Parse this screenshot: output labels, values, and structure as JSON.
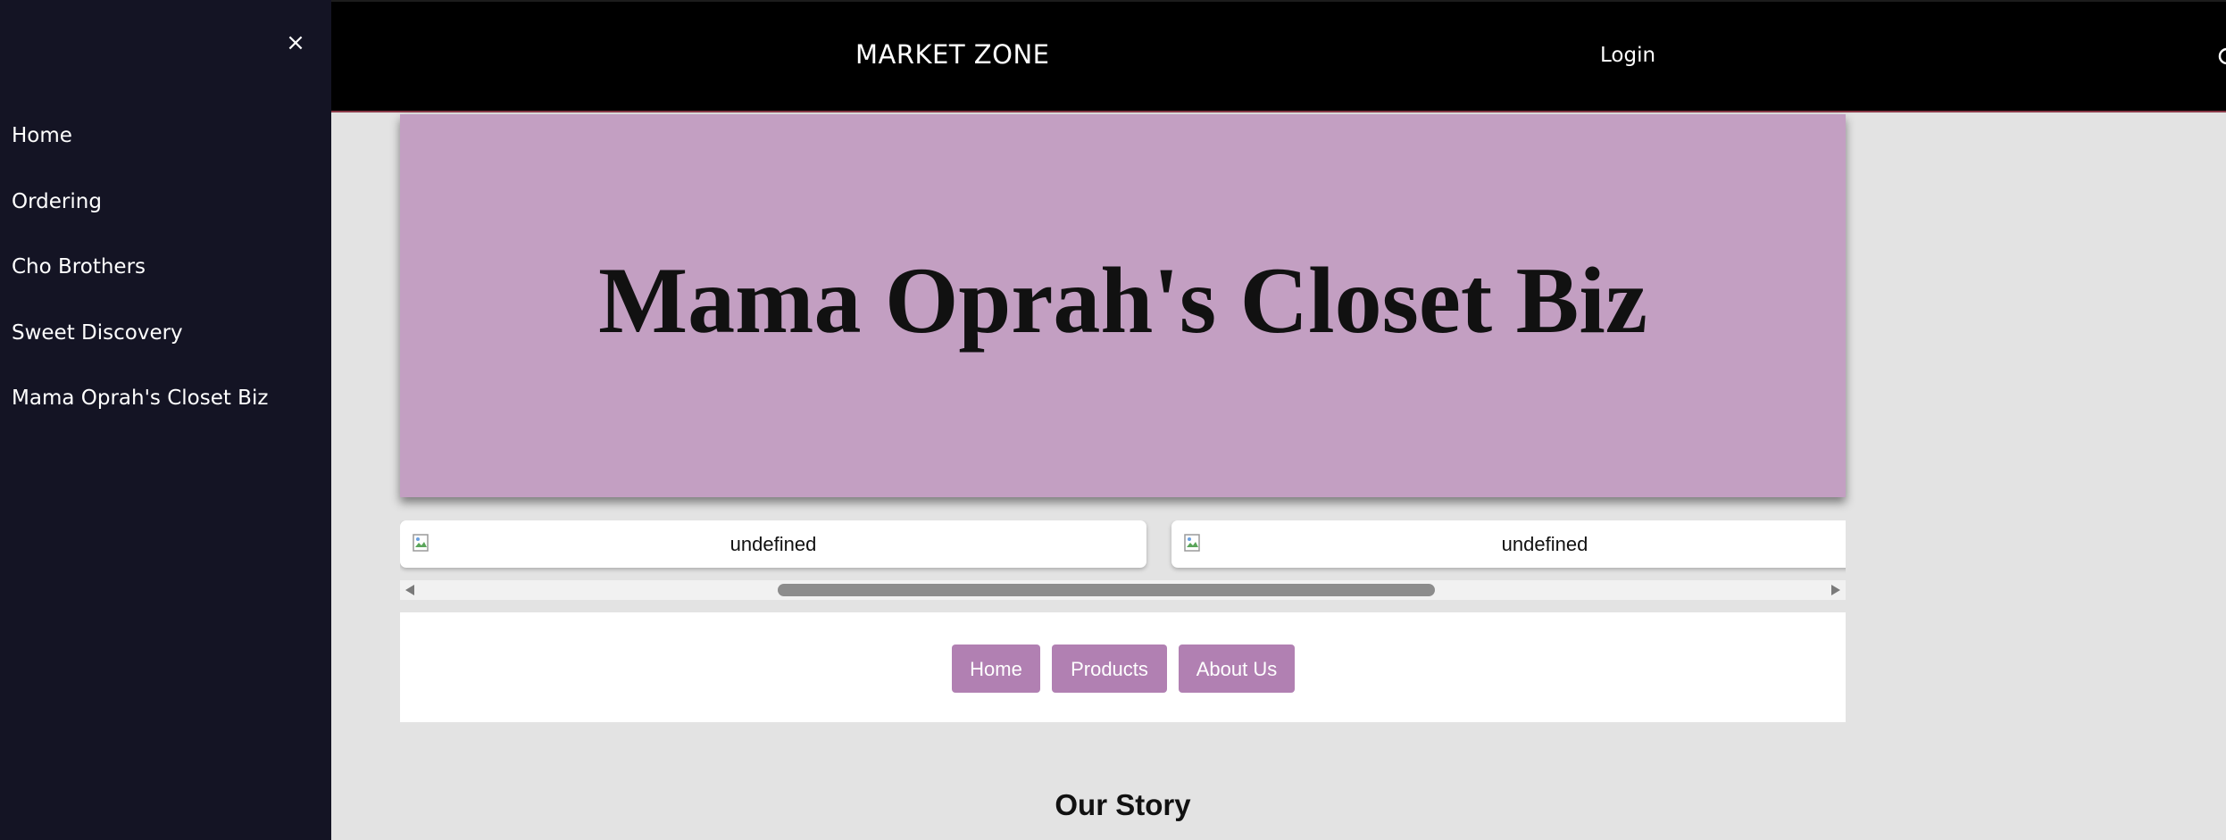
{
  "sidebar": {
    "close_icon": "×",
    "items": [
      {
        "label": "Home"
      },
      {
        "label": "Ordering"
      },
      {
        "label": "Cho Brothers"
      },
      {
        "label": "Sweet Discovery"
      },
      {
        "label": "Mama Oprah's Closet Biz"
      }
    ]
  },
  "header": {
    "brand": "MARKET ZONE",
    "login": "Login",
    "search_icon": "search-icon"
  },
  "hero": {
    "title": "Mama Oprah's Closet Biz",
    "background_color": "#c39fc2"
  },
  "carousel": {
    "images": [
      {
        "alt": "undefined"
      },
      {
        "alt": "undefined"
      }
    ]
  },
  "nav_buttons": {
    "home": "Home",
    "products": "Products",
    "about": "About Us",
    "color": "#b180b2"
  },
  "story": {
    "heading": "Our Story"
  }
}
